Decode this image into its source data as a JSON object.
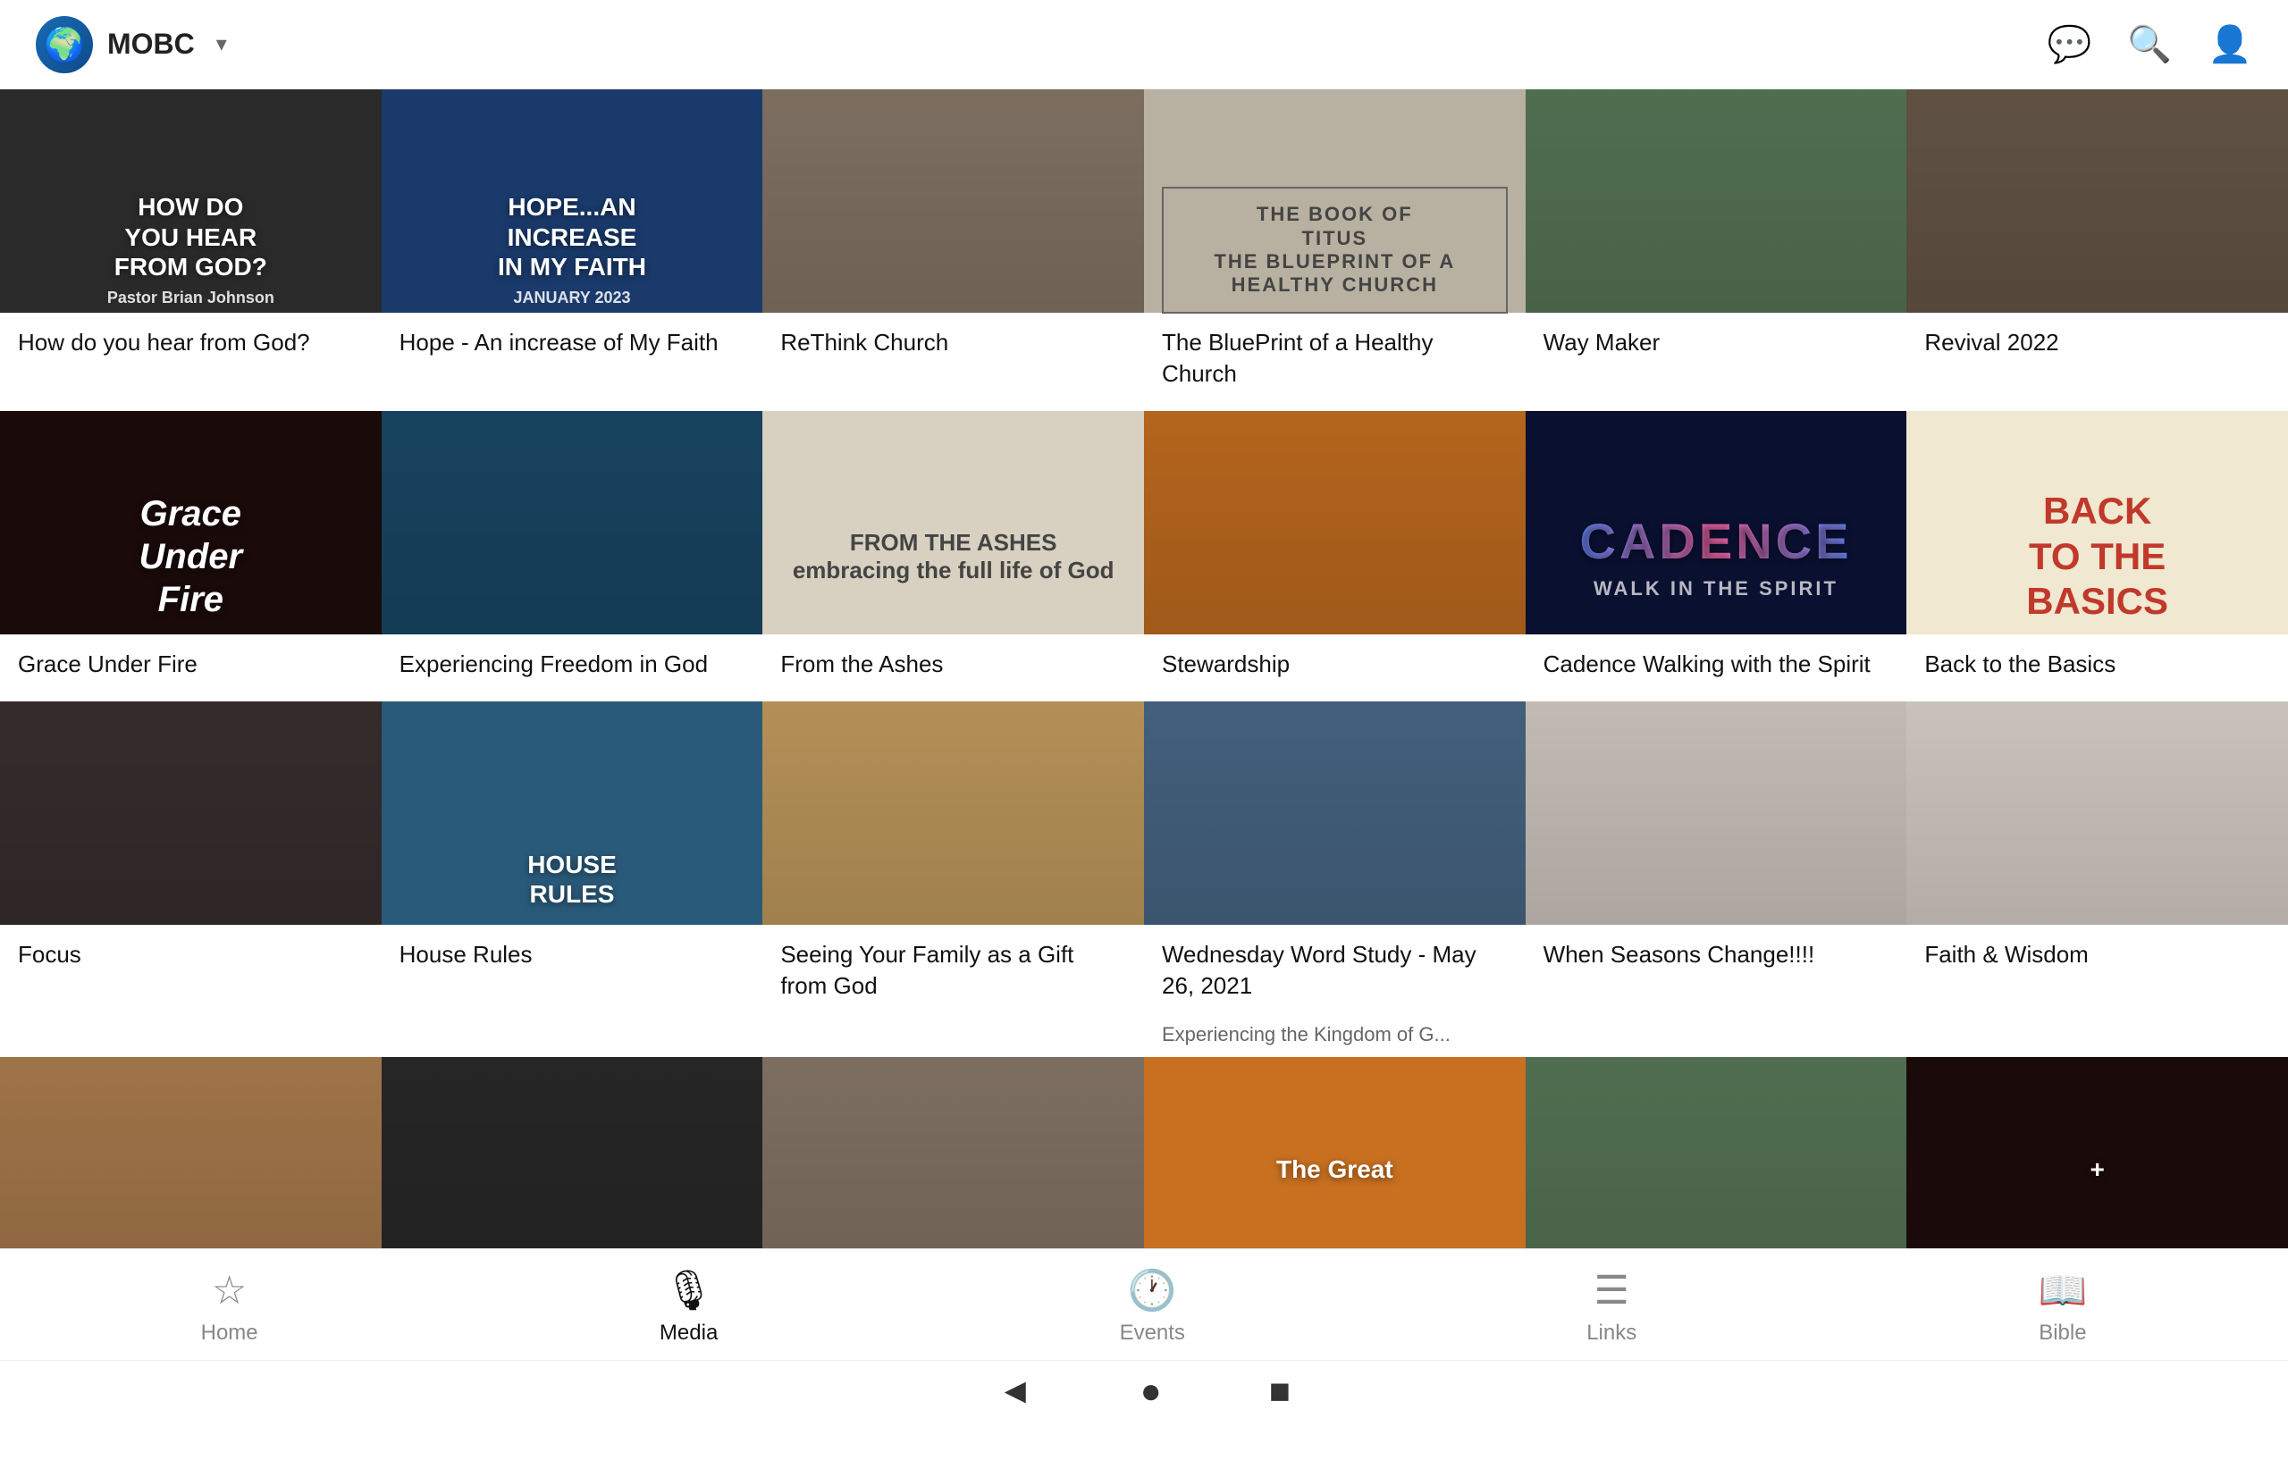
{
  "header": {
    "logo_emoji": "🌍",
    "org_name": "MOBC",
    "chevron": "▾",
    "icons": {
      "chat": "💬",
      "search": "🔍",
      "profile": "👤"
    }
  },
  "rows": [
    {
      "items": [
        {
          "id": "how-do-you-hear",
          "title": "How do you hear from God?",
          "bg_class": "bg-dark-road",
          "text_overlay": "HOW DO\nYOU HEAR\nFROM GOD?",
          "sub_overlay": "Pastor Brian Johnson",
          "text_color": "#fff",
          "accent": "#f5a623"
        },
        {
          "id": "hope-increase",
          "title": "Hope - An increase of My Faith",
          "bg_class": "bg-sermon",
          "text_overlay": "HOPE...AN\nINCREASE\nIN MY FAITH",
          "sub_overlay": "JANUARY 2023",
          "text_color": "#fff"
        },
        {
          "id": "rethink-church",
          "title": "ReThink Church",
          "bg_class": "bg-rethink",
          "text_overlay": "",
          "sub_overlay": "",
          "text_color": "#fff",
          "is_photo": true,
          "photo_desc": "microphone on desk photo"
        },
        {
          "id": "blueprint-healthy-church",
          "title": "The BluePrint of a Healthy Church",
          "bg_class": "bg-titus",
          "text_overlay": "THE BOOK OF\nTITUS\nTHE BLUEPRINT OF A HEALTHY CHURCH",
          "sub_overlay": "",
          "text_color": "#333"
        },
        {
          "id": "way-maker",
          "title": "Way Maker",
          "bg_class": "bg-greenleaf",
          "text_overlay": "",
          "sub_overlay": "",
          "text_color": "#fff",
          "is_photo": true,
          "photo_desc": "green leaves photo"
        },
        {
          "id": "revival-2022",
          "title": "Revival 2022",
          "bg_class": "bg-wood",
          "text_overlay": "",
          "sub_overlay": "",
          "text_color": "#fff",
          "is_photo": true,
          "photo_desc": "tree trunk cross section photo"
        }
      ]
    },
    {
      "items": [
        {
          "id": "grace-under-fire",
          "title": "Grace Under Fire",
          "bg_class": "bg-fire",
          "text_overlay": "Grace\nUnder\nFire",
          "sub_overlay": "",
          "text_color": "#fff"
        },
        {
          "id": "experiencing-freedom",
          "title": "Experiencing Freedom in God",
          "bg_class": "bg-confetti",
          "text_overlay": "",
          "sub_overlay": "",
          "text_color": "#fff",
          "is_photo": true,
          "photo_desc": "colorful confetti photo"
        },
        {
          "id": "from-the-ashes",
          "title": "From the Ashes",
          "bg_class": "bg-ashes",
          "text_overlay": "FROM THE ASHES\nembracing the full life of God",
          "sub_overlay": "",
          "text_color": "#555"
        },
        {
          "id": "stewardship",
          "title": "Stewardship",
          "bg_class": "bg-sunset",
          "text_overlay": "",
          "sub_overlay": "",
          "text_color": "#fff",
          "is_photo": true,
          "photo_desc": "sunset landscape photo"
        },
        {
          "id": "cadence",
          "title": "Cadence Walking with the Spirit",
          "bg_class": "bg-cadence",
          "text_overlay": "CADENCE",
          "sub_overlay": "WALK IN THE SPIRIT",
          "text_color": "#fff",
          "accent": "#6a8aff"
        },
        {
          "id": "back-to-basics",
          "title": "Back to the Basics",
          "bg_class": "bg-basics",
          "text_overlay": "BACK\nTO THE\nBASICS",
          "sub_overlay": "",
          "text_color": "#c0392b"
        }
      ]
    },
    {
      "items": [
        {
          "id": "focus",
          "title": "Focus",
          "bg_class": "bg-logs",
          "text_overlay": "",
          "sub_overlay": "",
          "text_color": "#fff",
          "is_photo": true,
          "photo_desc": "stacked logs photo"
        },
        {
          "id": "house-rules",
          "title": "House Rules",
          "bg_class": "bg-houserules",
          "text_overlay": "HOUSE\nRULES",
          "sub_overlay": "",
          "text_color": "#fff"
        },
        {
          "id": "seeing-family-gift",
          "title": "Seeing Your Family as a Gift from God",
          "bg_class": "bg-desert",
          "text_overlay": "",
          "sub_overlay": "",
          "text_color": "#fff",
          "is_photo": true,
          "photo_desc": "desert dunes photo"
        },
        {
          "id": "wednesday-word-study",
          "title": "Wednesday Word Study - May 26, 2021",
          "subtitle": "Experiencing the Kingdom of G...",
          "bg_class": "bg-lake",
          "text_overlay": "",
          "sub_overlay": "",
          "text_color": "#fff",
          "is_photo": true,
          "photo_desc": "mountain lake cabin photo"
        },
        {
          "id": "when-seasons-change",
          "title": "When Seasons Change!!!!",
          "bg_class": "bg-flowers",
          "text_overlay": "",
          "sub_overlay": "",
          "text_color": "#333",
          "is_photo": true,
          "photo_desc": "magnolia flowers photo"
        },
        {
          "id": "faith-wisdom",
          "title": "Faith & Wisdom",
          "bg_class": "bg-hand",
          "text_overlay": "",
          "sub_overlay": "",
          "text_color": "#333",
          "is_photo": true,
          "photo_desc": "hand placing object photo"
        }
      ]
    },
    {
      "items": [
        {
          "id": "partial-1",
          "title": "",
          "bg_class": "bg-partial",
          "is_photo": true,
          "text_overlay": "",
          "sub_overlay": "",
          "text_color": "#fff"
        },
        {
          "id": "partial-2",
          "title": "",
          "bg_class": "bg-dark-road",
          "is_photo": true,
          "text_overlay": "",
          "sub_overlay": "",
          "text_color": "#fff"
        },
        {
          "id": "partial-3",
          "title": "",
          "bg_class": "bg-rethink",
          "is_photo": true,
          "text_overlay": "",
          "sub_overlay": "",
          "text_color": "#fff"
        },
        {
          "id": "partial-4",
          "title": "",
          "bg_class": "bg-sunset",
          "is_photo": true,
          "text_overlay": "The Great",
          "sub_overlay": "",
          "text_color": "#fff"
        },
        {
          "id": "partial-5",
          "title": "",
          "bg_class": "bg-greenleaf",
          "is_photo": true,
          "text_overlay": "",
          "sub_overlay": "",
          "text_color": "#fff"
        },
        {
          "id": "partial-6",
          "title": "",
          "bg_class": "bg-fire",
          "is_photo": true,
          "text_overlay": "+",
          "sub_overlay": "",
          "text_color": "#fff"
        }
      ]
    }
  ],
  "bottom_nav": {
    "tabs": [
      {
        "id": "home",
        "label": "Home",
        "icon": "☆",
        "active": false
      },
      {
        "id": "media",
        "label": "Media",
        "icon": "🎙",
        "active": true
      },
      {
        "id": "events",
        "label": "Events",
        "icon": "🕐",
        "active": false
      },
      {
        "id": "links",
        "label": "Links",
        "icon": "☰",
        "active": false
      },
      {
        "id": "bible",
        "label": "Bible",
        "icon": "📖",
        "active": false
      }
    ],
    "system_buttons": [
      "◄",
      "●",
      "■"
    ]
  }
}
